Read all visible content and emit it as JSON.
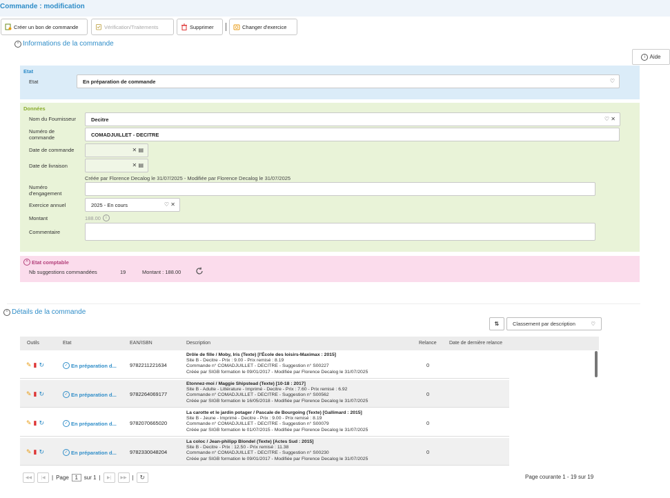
{
  "header": {
    "title": "Commande : modification"
  },
  "toolbar": {
    "create_order": "Créer un bon de commande",
    "verification": "Vérification/Traitements",
    "delete": "Supprimer",
    "change_year": "Changer d'exercice"
  },
  "help": {
    "label": "Aide"
  },
  "info_section": {
    "title": "Informations de la commande"
  },
  "etat_panel": {
    "title": "Etat",
    "label": "Etat",
    "value": "En préparation de commande"
  },
  "donnees_panel": {
    "title": "Données",
    "supplier_label": "Nom du Fournisseur",
    "supplier_value": "Decitre",
    "order_number_label": "Numéro de commande",
    "order_number_value": "COMADJUILLET - DECITRE",
    "order_date_label": "Date de commande",
    "delivery_date_label": "Date de livraison",
    "created_info": "Créée par Florence Decalog le 31/07/2025 - Modifiée par Florence Decalog le 31/07/2025",
    "engagement_label": "Numéro d'engagement",
    "year_label": "Exercice annuel",
    "year_value": "2025 - En cours",
    "amount_label": "Montant",
    "amount_value": "188.00",
    "comment_label": "Commentaire"
  },
  "compta_panel": {
    "title": "Etat comptable",
    "count_label": "Nb suggestions commandées",
    "count_value": "19",
    "amount_text": "Montant : 188.00"
  },
  "details_section": {
    "title": "Détails de la commande",
    "sort_value": "Classement par description"
  },
  "table": {
    "headers": [
      "Outils",
      "Etat",
      "EAN/ISBN",
      "Description",
      "Relance",
      "Date de dernière relance"
    ],
    "rows": [
      {
        "status": "En préparation d...",
        "ean": "9782211221634",
        "title": "Drôle de fille / Moby, Iris (Texte) [l'École des loisirs-Maximax : 2015]",
        "line2": "Site B - Decitre - Prix : 9.00 - Prix remisé : 8.19",
        "line3": "Commande n° COMADJUILLET - DECITRE - Suggestion n° S00227",
        "line4": "Créée par SIGB formation le 09/01/2017 - Modifiée par Florence Decalog le 31/07/2025",
        "relance": "0"
      },
      {
        "status": "En préparation d...",
        "ean": "9782264069177",
        "title": "Etonnez-moi / Maggie Shipstead (Texte) [10-18 : 2017]",
        "line2": "Site B - Adulte - Littérature - Imprimé - Decitre - Prix : 7.60 - Prix remisé : 6.92",
        "line3": "Commande n° COMADJUILLET - DECITRE - Suggestion n° S00562",
        "line4": "Créée par SIGB formation le 16/05/2018 - Modifiée par Florence Decalog le 31/07/2025",
        "relance": "0"
      },
      {
        "status": "En préparation d...",
        "ean": "9782070665020",
        "title": "La carotte et le jardin potager / Pascale de Bourgoing (Texte) [Gallimard : 2015]",
        "line2": "Site B - Jeune - Imprimé - Decitre - Prix : 9.00 - Prix remisé : 8.19",
        "line3": "Commande n° COMADJUILLET - DECITRE - Suggestion n° S00079",
        "line4": "Créée par SIGB formation le 01/07/2015 - Modifiée par Florence Decalog le 31/07/2025",
        "relance": "0"
      },
      {
        "status": "En préparation d...",
        "ean": "9782330048204",
        "title": "La coloc / Jean-philipp Blondel (Texte) [Actes Sud : 2015]",
        "line2": "Site B - Decitre - Prix : 12.50 - Prix remisé : 11.38",
        "line3": "Commande n° COMADJUILLET - DECITRE - Suggestion n° S00230",
        "line4": "Créée par SIGB formation le 09/01/2017 - Modifiée par Florence Decalog le 31/07/2025",
        "relance": "0"
      }
    ]
  },
  "pager": {
    "page_label": "Page",
    "page_value": "1",
    "of_label": "sur 1",
    "summary": "Page courante 1 - 19 sur 19"
  }
}
